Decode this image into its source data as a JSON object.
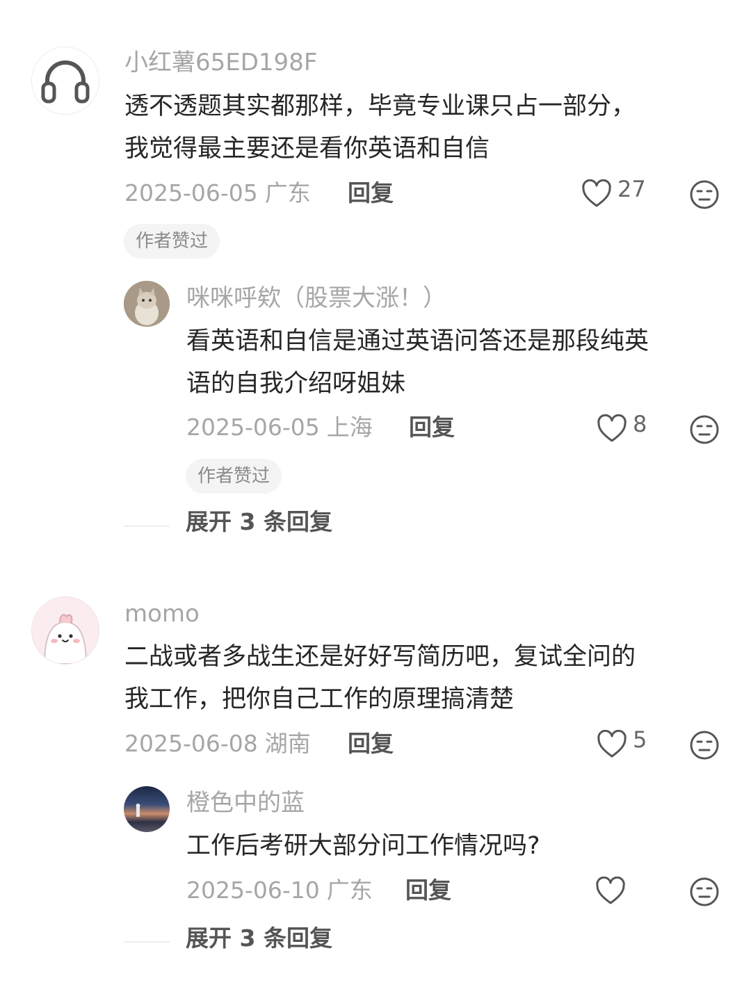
{
  "comments": [
    {
      "username": "小红薯65ED198F",
      "text_lines": [
        "透不透题其实都那样，毕竟专业课只占一部分，",
        "我觉得最主要还是看你英语和自信"
      ],
      "date": "2025-06-05",
      "location": "广东",
      "reply_label": "回复",
      "likes": "27",
      "badge": "作者赞过",
      "avatar_icon": "headphones-icon",
      "replies": [
        {
          "username": "咪咪呼欸（股票大涨！）",
          "text_lines": [
            "看英语和自信是通过英语问答还是那段纯英",
            "语的自我介绍呀姐妹"
          ],
          "date": "2025-06-05",
          "location": "上海",
          "reply_label": "回复",
          "likes": "8",
          "badge": "作者赞过",
          "avatar_icon": "cat-photo"
        }
      ],
      "expand_label": "展开 3 条回复"
    },
    {
      "username": "momo",
      "text_lines": [
        "二战或者多战生还是好好写简历吧，复试全问的",
        "我工作，把你自己工作的原理搞清楚"
      ],
      "date": "2025-06-08",
      "location": "湖南",
      "reply_label": "回复",
      "likes": "5",
      "avatar_icon": "cute-cartoon-avatar",
      "replies": [
        {
          "username": "橙色中的蓝",
          "text_lines": [
            "工作后考研大部分问工作情况吗?"
          ],
          "date": "2025-06-10",
          "location": "广东",
          "reply_label": "回复",
          "likes": "",
          "avatar_icon": "sunset-beach-photo"
        }
      ],
      "expand_label": "展开 3 条回复"
    }
  ],
  "colors": {
    "username": "#a6a6a6",
    "text": "#262626",
    "meta": "#a6a6a6",
    "badge_bg": "#f4f4f4"
  }
}
